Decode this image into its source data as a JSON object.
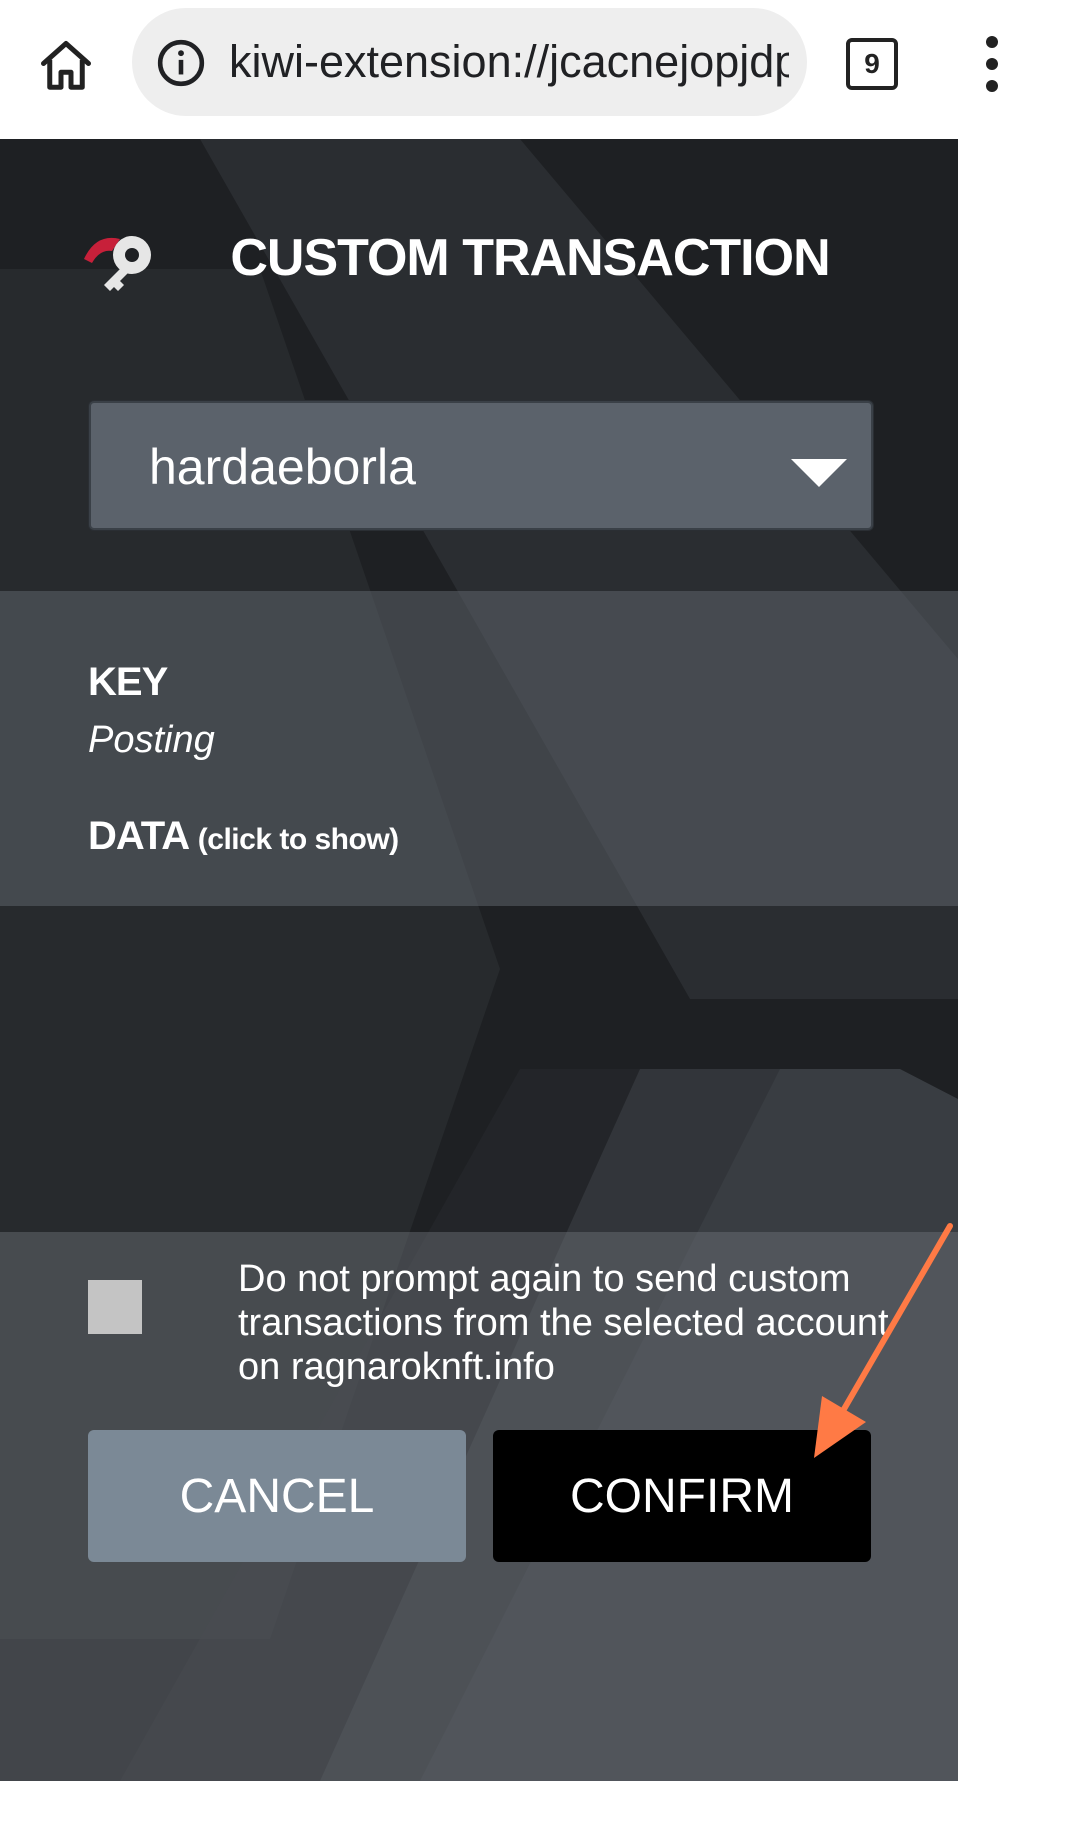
{
  "browser": {
    "url": "kiwi-extension://jcacnejopjdp",
    "tab_count": "9"
  },
  "dialog": {
    "title": "CUSTOM TRANSACTION",
    "account": {
      "selected": "hardaeborla"
    },
    "key_label": "KEY",
    "key_value": "Posting",
    "data_label": "DATA",
    "data_hint": "(click to show)",
    "checkbox_label": "Do not prompt again to send custom transactions from the selected account on ragnaroknft.info",
    "checkbox_checked": false,
    "cancel_label": "CANCEL",
    "confirm_label": "CONFIRM"
  },
  "colors": {
    "panel_bg": "#1e2023",
    "select_bg": "#5b626b",
    "cancel_bg": "#7b8996",
    "confirm_bg": "#000000",
    "logo_accent": "#c7203a",
    "annotation_arrow": "#ff7a45"
  },
  "icons": {
    "home": "home-icon",
    "info": "info-icon",
    "tabs": "tabs-icon",
    "menu": "more-vert-icon",
    "logo": "hive-keychain-logo-icon",
    "dropdown": "caret-down-icon",
    "arrow": "annotation-arrow-icon"
  }
}
